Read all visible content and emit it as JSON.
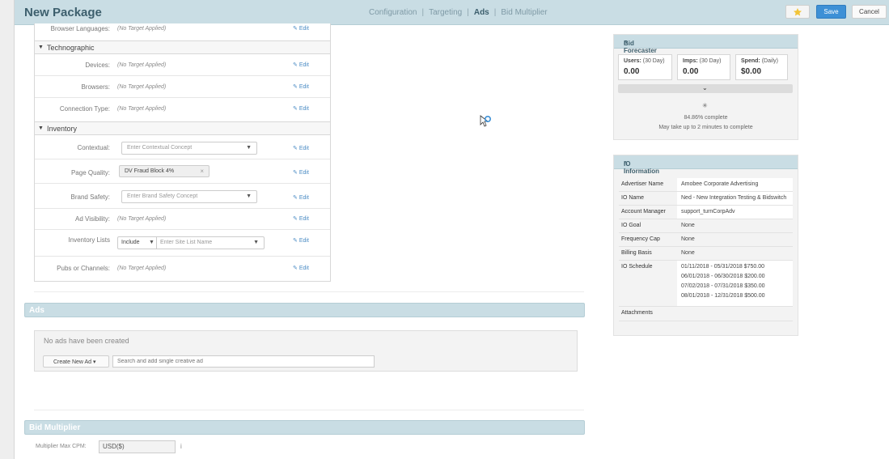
{
  "header": {
    "title": "New Package",
    "nav": [
      "Configuration",
      "Targeting",
      "Ads",
      "Bid Multiplier"
    ],
    "nav_active": "Ads",
    "save_label": "Save",
    "cancel_label": "Cancel",
    "accent_color": "#3d90d6"
  },
  "targeting": {
    "browser_languages": {
      "label": "Browser Languages:",
      "value": "(No Target Applied)"
    },
    "technographic": {
      "title": "Technographic",
      "devices": {
        "label": "Devices:",
        "value": "(No Target Applied)"
      },
      "browsers": {
        "label": "Browsers:",
        "value": "(No Target Applied)"
      },
      "connection_type": {
        "label": "Connection Type:",
        "value": "(No Target Applied)"
      }
    },
    "inventory": {
      "title": "Inventory",
      "contextual": {
        "label": "Contextual:",
        "placeholder": "Enter Contextual Concept"
      },
      "page_quality": {
        "label": "Page Quality:",
        "tag": "DV Fraud Block 4%"
      },
      "brand_safety": {
        "label": "Brand Safety:",
        "placeholder": "Enter Brand Safety Concept"
      },
      "ad_visibility": {
        "label": "Ad Visibility:",
        "value": "(No Target Applied)"
      },
      "inventory_lists": {
        "label": "Inventory Lists",
        "mode": "Include",
        "placeholder": "Enter Site List Name"
      },
      "pubs_channels": {
        "label": "Pubs or Channels:",
        "value": "(No Target Applied)"
      }
    },
    "edit_label": "Edit"
  },
  "ads": {
    "title": "Ads",
    "empty_text": "No ads have been created",
    "create_label": "Create New Ad",
    "search_placeholder": "Search and add single creative ad"
  },
  "bid_multiplier": {
    "title": "Bid Multiplier",
    "max_cpm_label": "Multiplier Max CPM:",
    "currency": "USD($)",
    "info": "i"
  },
  "bid_forecaster": {
    "title": "Bid Forecaster",
    "users": {
      "label": "Users:",
      "period": "(30 Day)",
      "value": "0.00"
    },
    "imps": {
      "label": "Imps:",
      "period": "(30 Day)",
      "value": "0.00"
    },
    "spend": {
      "label": "Spend:",
      "period": "(Daily)",
      "value": "$0.00"
    },
    "progress_text": "84.86% complete",
    "progress": 84.86,
    "note": "May take up to 2 minutes to complete"
  },
  "io_information": {
    "title": "IO Information",
    "rows": [
      {
        "key": "Advertiser Name",
        "value": "Amobee Corporate Advertising"
      },
      {
        "key": "IO Name",
        "value": "Ned - New Integration Testing & Bidswitch"
      },
      {
        "key": "Account Manager",
        "value": "support_turnCorpAdv"
      },
      {
        "key": "IO Goal",
        "value": "None"
      },
      {
        "key": "Frequency Cap",
        "value": "None"
      },
      {
        "key": "Billing Basis",
        "value": "None"
      }
    ],
    "schedule_label": "IO Schedule",
    "schedule": [
      "01/11/2018 - 05/31/2018   $750.00",
      "06/01/2018 - 06/30/2018   $200.00",
      "07/02/2018 - 07/31/2018   $350.00",
      "08/01/2018 - 12/31/2018   $500.00"
    ],
    "attachments_label": "Attachments"
  }
}
